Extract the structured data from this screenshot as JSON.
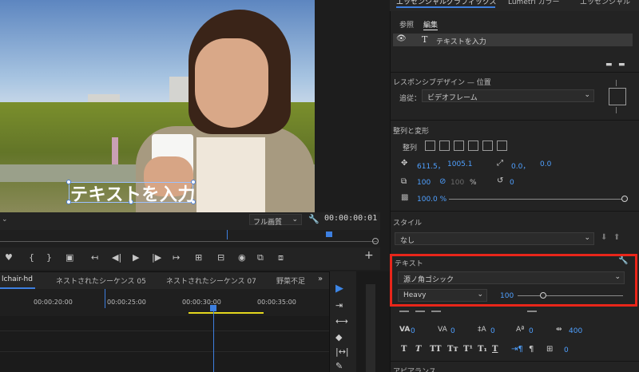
{
  "viewer": {
    "overlay_text": "テキストを入力",
    "quality": "フル画質",
    "timecode": "00:00:00:01"
  },
  "timeline": {
    "tabs": [
      "lchair-hd",
      "ネストされたシーケンス 05",
      "ネストされたシーケンス 07",
      "野菜不足"
    ],
    "timecodes": [
      "00:00:20:00",
      "00:00:25:00",
      "00:00:30:00",
      "00:00:35:00"
    ]
  },
  "panel": {
    "header": {
      "tab_left": "エッセンシャルグラフィックス",
      "tab_mid": "Lumetri カラー",
      "tab_right": "エッセンシャル"
    },
    "subtabs": [
      "参照",
      "編集"
    ],
    "layer_label": "テキストを入力",
    "responsive": {
      "title": "レスポンシブデザイン — 位置",
      "follow_label": "追従：",
      "follow_value": "ビデオフレーム"
    },
    "align": {
      "title": "整列と変形",
      "align_label": "整列",
      "pos_x": "611.5，",
      "pos_y": "1005.1",
      "anchor_x": "0.0，",
      "anchor_y": "0.0",
      "scale_w": "100",
      "scale_h": "100",
      "percent": "%",
      "rotation": "0",
      "opacity": "100.0 %"
    },
    "style": {
      "title": "スタイル",
      "value": "なし"
    },
    "text": {
      "title": "テキスト",
      "font": "源ノ角ゴシック",
      "weight": "Heavy",
      "size": "100",
      "tracking_a": "0",
      "tracking_b": "0",
      "leading": "0",
      "kerning": "0",
      "baseline": "0",
      "tsume": "400",
      "tab_width": "0",
      "format_buttons": [
        "T",
        "T",
        "TT",
        "Tт",
        "T¹",
        "T₁",
        "T"
      ]
    },
    "appearance_title": "アピアランス"
  },
  "colors": {
    "highlight": "#e8261a",
    "accent": "#4fa0ff"
  }
}
